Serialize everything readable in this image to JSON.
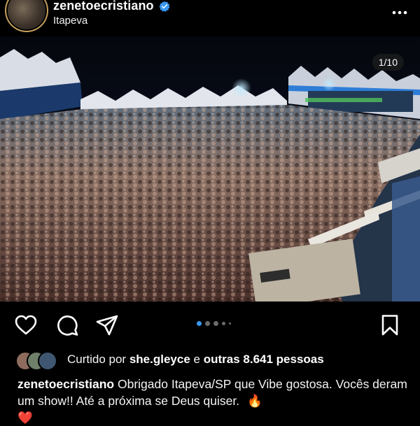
{
  "post": {
    "username": "zenetoecristiano",
    "location": "Itapeva",
    "counter": "1/10"
  },
  "icons": {
    "avatar": "profile-photo",
    "verified": "verified-badge-icon",
    "more": "more-options-icon",
    "like": "heart-icon",
    "comment": "comment-bubble-icon",
    "share": "paper-plane-icon",
    "save": "bookmark-icon",
    "fire": "fire-emoji",
    "heart_emoji": "red-heart-emoji"
  },
  "carousel": {
    "active_index": 1,
    "dots_visible": 5
  },
  "likes": {
    "prefix": "Curtido por",
    "user": "she.gleyce",
    "conjunction": "e",
    "others": "outras 8.641 pessoas"
  },
  "caption": {
    "username": "zenetoecristiano",
    "text": "Obrigado Itapeva/SP que Vibe gostosa. Vocês deram um show!! Até a próxima se Deus quiser.",
    "emoji_1": "🔥",
    "emoji_2": "❤️"
  },
  "colors": {
    "background": "#000000",
    "verified_blue": "#3897f0",
    "active_dot": "#3897f0",
    "inactive_dot": "#6b6b6b"
  }
}
